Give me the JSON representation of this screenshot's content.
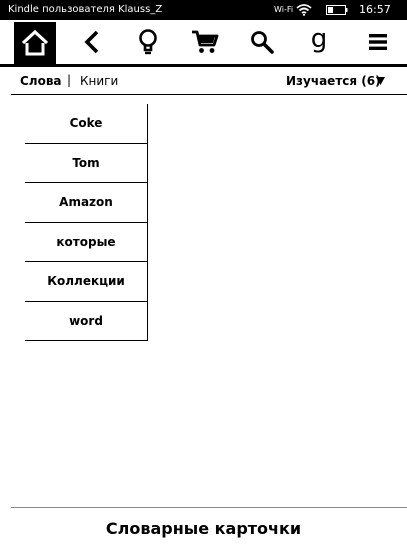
{
  "status_bar": {
    "title": "Kindle пользователя Klauss_Z",
    "wifi_label": "Wi-Fi",
    "time": "16:57"
  },
  "toolbar": {
    "icons": [
      "home-icon",
      "back-icon",
      "lightbulb-icon",
      "cart-icon",
      "search-icon",
      "goodreads-icon",
      "menu-icon"
    ],
    "goodreads_glyph": "g"
  },
  "subheader": {
    "words_tab": "Слова",
    "separator": "|",
    "books_tab": "Книги",
    "filter_label": "Изучается (6)"
  },
  "words": [
    "Coke",
    "Tom",
    "Amazon",
    "которые",
    "Коллекции",
    "word"
  ],
  "footer": {
    "title": "Словарные карточки"
  }
}
